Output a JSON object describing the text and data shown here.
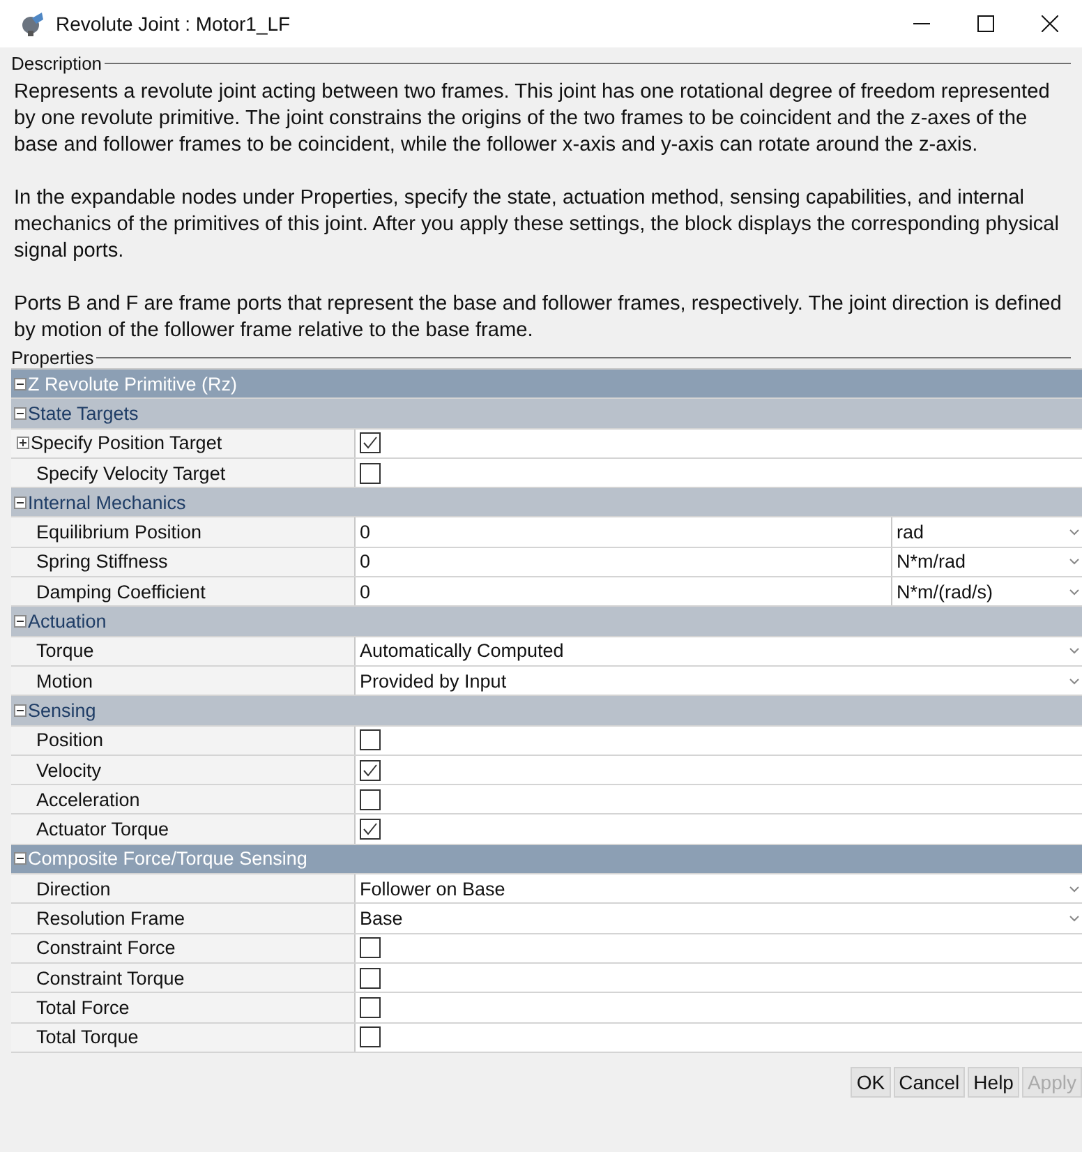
{
  "window": {
    "title": "Revolute Joint : Motor1_LF"
  },
  "description": {
    "legend": "Description",
    "paragraphs": [
      "Represents a revolute joint acting between two frames. This joint has one rotational degree of freedom represented by one revolute primitive. The joint constrains the origins of the two frames to be coincident and the z-axes of the base and follower frames to be coincident, while the follower x-axis and y-axis can rotate around the z-axis.",
      "In the expandable nodes under Properties, specify the state, actuation method, sensing capabilities, and internal mechanics of the primitives of this joint. After you apply these settings, the block displays the corresponding physical signal ports.",
      "Ports B and F are frame ports that represent the base and follower frames, respectively. The joint direction is defined by motion of the follower frame relative to the base frame."
    ]
  },
  "properties": {
    "legend": "Properties",
    "sections": [
      {
        "label": "Z Revolute Primitive (Rz)",
        "expanded": true,
        "children": [
          {
            "label": "State Targets",
            "expanded": true,
            "children": [
              {
                "kind": "checkbox",
                "label": "Specify Position Target",
                "expanded": false,
                "checked": true
              },
              {
                "kind": "checkbox",
                "label": "Specify Velocity Target",
                "checked": false
              }
            ]
          },
          {
            "label": "Internal Mechanics",
            "expanded": true,
            "children": [
              {
                "kind": "number",
                "label": "Equilibrium Position",
                "value": "0",
                "unit": "rad"
              },
              {
                "kind": "number",
                "label": "Spring Stiffness",
                "value": "0",
                "unit": "N*m/rad"
              },
              {
                "kind": "number",
                "label": "Damping Coefficient",
                "value": "0",
                "unit": "N*m/(rad/s)"
              }
            ]
          },
          {
            "label": "Actuation",
            "expanded": true,
            "children": [
              {
                "kind": "dropdown",
                "label": "Torque",
                "value": "Automatically Computed"
              },
              {
                "kind": "dropdown",
                "label": "Motion",
                "value": "Provided by Input"
              }
            ]
          },
          {
            "label": "Sensing",
            "expanded": true,
            "children": [
              {
                "kind": "checkbox",
                "label": "Position",
                "checked": false
              },
              {
                "kind": "checkbox",
                "label": "Velocity",
                "checked": true
              },
              {
                "kind": "checkbox",
                "label": "Acceleration",
                "checked": false
              },
              {
                "kind": "checkbox",
                "label": "Actuator Torque",
                "checked": true
              }
            ]
          }
        ]
      },
      {
        "label": "Composite Force/Torque Sensing",
        "expanded": true,
        "children": [
          {
            "kind": "dropdown",
            "label": "Direction",
            "value": "Follower on Base"
          },
          {
            "kind": "dropdown",
            "label": "Resolution Frame",
            "value": "Base"
          },
          {
            "kind": "checkbox",
            "label": "Constraint Force",
            "checked": false
          },
          {
            "kind": "checkbox",
            "label": "Constraint Torque",
            "checked": false
          },
          {
            "kind": "checkbox",
            "label": "Total Force",
            "checked": false
          },
          {
            "kind": "checkbox",
            "label": "Total Torque",
            "checked": false
          }
        ]
      }
    ]
  },
  "buttons": [
    {
      "label": "OK",
      "disabled": false
    },
    {
      "label": "Cancel",
      "disabled": false
    },
    {
      "label": "Help",
      "disabled": false
    },
    {
      "label": "Apply",
      "disabled": true
    }
  ]
}
